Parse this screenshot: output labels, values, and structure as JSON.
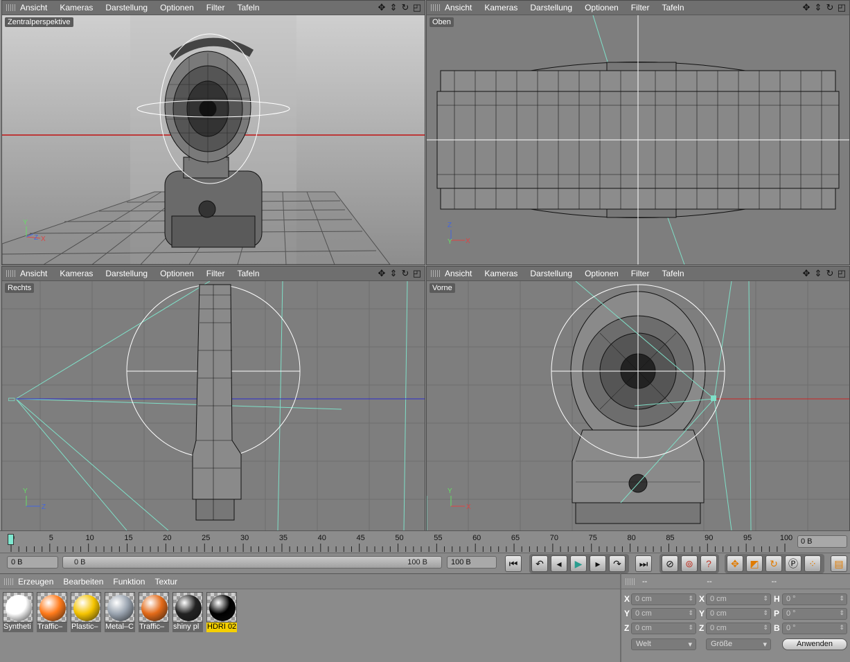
{
  "viewport_menu": [
    "Ansicht",
    "Kameras",
    "Darstellung",
    "Optionen",
    "Filter",
    "Tafeln"
  ],
  "viewports": [
    {
      "label": "Zentralperspektive"
    },
    {
      "label": "Oben"
    },
    {
      "label": "Rechts"
    },
    {
      "label": "Vorne"
    }
  ],
  "axis_letters": {
    "x": "X",
    "y": "Y",
    "z": "Z"
  },
  "timeline": {
    "ticks": [
      "0",
      "5",
      "10",
      "15",
      "20",
      "25",
      "30",
      "35",
      "40",
      "45",
      "50",
      "55",
      "60",
      "65",
      "70",
      "75",
      "80",
      "85",
      "90",
      "95",
      "100"
    ],
    "current_frame": "0 B"
  },
  "transport": {
    "start_field": "0 B",
    "slider_min": "0 B",
    "slider_max": "100 B",
    "end_field": "100 B"
  },
  "material_manager": {
    "menu": [
      "Erzeugen",
      "Bearbeiten",
      "Funktion",
      "Textur"
    ],
    "materials": [
      {
        "name": "Syntheti",
        "color": "#ffffff"
      },
      {
        "name": "Traffic–",
        "color": "#ff7a1a"
      },
      {
        "name": "Plastic–",
        "color": "#f5c400"
      },
      {
        "name": "Metal–C",
        "color": "#9aa4b0"
      },
      {
        "name": "Traffic–",
        "color": "#e36a18"
      },
      {
        "name": "shiny pl",
        "color": "#222222"
      },
      {
        "name": "HDRI 02",
        "color": "#000000",
        "selected": true
      }
    ]
  },
  "coordinates": {
    "headers": [
      "--",
      "--",
      "--"
    ],
    "rows": [
      {
        "l1": "X",
        "v1": "0 cm",
        "l2": "X",
        "v2": "0 cm",
        "l3": "H",
        "v3": "0 °"
      },
      {
        "l1": "Y",
        "v1": "0 cm",
        "l2": "Y",
        "v2": "0 cm",
        "l3": "P",
        "v3": "0 °"
      },
      {
        "l1": "Z",
        "v1": "0 cm",
        "l2": "Z",
        "v2": "0 cm",
        "l3": "B",
        "v3": "0 °"
      }
    ],
    "space_dropdown": "Welt",
    "size_dropdown": "Größe",
    "apply_label": "Anwenden"
  }
}
